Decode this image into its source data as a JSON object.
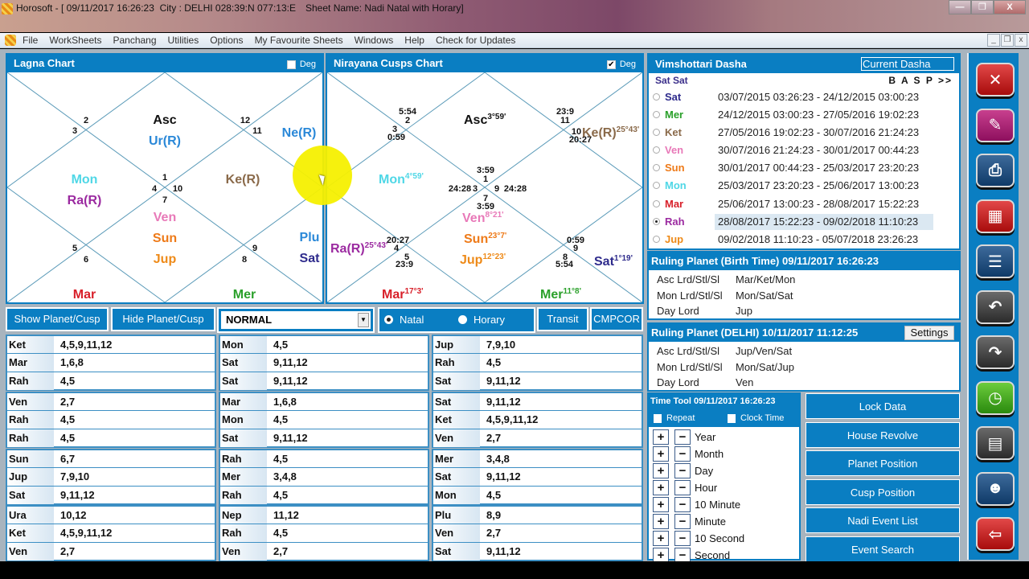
{
  "window": {
    "title": "Horosoft - [ 09/11/2017 16:26:23  City : DELHI 028:39:N 077:13:E",
    "sheet_name": "Sheet Name: Nadi Natal with Horary]",
    "controls": {
      "minimize": "—",
      "restore": "❐",
      "close": "X"
    }
  },
  "menu": {
    "items": [
      "File",
      "WorkSheets",
      "Panchang",
      "Utilities",
      "Options",
      "My Favourite Sheets",
      "Windows",
      "Help",
      "Check for Updates"
    ],
    "mdi_controls": {
      "minimize": "_",
      "restore": "❐",
      "close": "x"
    }
  },
  "colors": {
    "accent": "#0a7ec2",
    "Asc": "#111111",
    "Ura": "#2a88d8",
    "Nep": "#2a88d8",
    "Mon": "#4fd7e6",
    "Rah": "#9b2aa0",
    "Ket": "#8a6a4a",
    "Ven": "#e879b8",
    "Sun": "#ee7a18",
    "Jup": "#ee8a18",
    "Plu": "#2a88d8",
    "Sat": "#2e2b8c",
    "Mar": "#d8202a",
    "Mer": "#2aa02a"
  },
  "lagna_chart": {
    "title": "Lagna Chart",
    "deg_label": "Deg",
    "deg_checked": false,
    "house_numbers": [
      "1",
      "2",
      "3",
      "4",
      "5",
      "6",
      "7",
      "8",
      "9",
      "10",
      "11",
      "12"
    ],
    "planets": [
      {
        "text": "Asc",
        "key": "Asc",
        "house": 1
      },
      {
        "text": "Ur(R)",
        "key": "Ura",
        "house": 1
      },
      {
        "text": "Ne(R)",
        "key": "Nep",
        "house": 11
      },
      {
        "text": "Mon",
        "key": "Mon",
        "house": 4
      },
      {
        "text": "Ra(R)",
        "key": "Rah",
        "house": 4
      },
      {
        "text": "Ke(R)",
        "key": "Ket",
        "house": 10
      },
      {
        "text": "Ven",
        "key": "Ven",
        "house": 7
      },
      {
        "text": "Sun",
        "key": "Sun",
        "house": 7
      },
      {
        "text": "Jup",
        "key": "Jup",
        "house": 7
      },
      {
        "text": "Plu",
        "key": "Plu",
        "house": 9
      },
      {
        "text": "Sat",
        "key": "Sat",
        "house": 9
      },
      {
        "text": "Mar",
        "key": "Mar",
        "house": 6
      },
      {
        "text": "Mer",
        "key": "Mer",
        "house": 8
      }
    ]
  },
  "cusps_chart": {
    "title": "Nirayana Cusps Chart",
    "deg_label": "Deg",
    "deg_checked": true,
    "cusp_degrees": {
      "1": "3:59",
      "2": "5:54",
      "3": "0:59",
      "3c": "24:28",
      "4": "20:27",
      "5": "23:9",
      "7": "3:59",
      "8": "5:54",
      "9": "0:59",
      "9c": "24:28",
      "10": "20:27",
      "11": "23:9"
    },
    "planets": [
      {
        "text": "Asc",
        "deg": "3°59'",
        "key": "Asc",
        "house": 1
      },
      {
        "text": "Ke(R)",
        "deg": "25°43'",
        "key": "Ket",
        "house": 10
      },
      {
        "text": "Mon",
        "deg": "4°59'",
        "key": "Mon",
        "house": 4
      },
      {
        "text": "Ven",
        "deg": "8°21'",
        "key": "Ven",
        "house": 7
      },
      {
        "text": "Sun",
        "deg": "23°7'",
        "key": "Sun",
        "house": 7
      },
      {
        "text": "Jup",
        "deg": "12°23'",
        "key": "Jup",
        "house": 7
      },
      {
        "text": "Ra(R)",
        "deg": "25°43'",
        "key": "Rah",
        "house": 4
      },
      {
        "text": "Sat",
        "deg": "1°19'",
        "key": "Sat",
        "house": 9
      },
      {
        "text": "Mar",
        "deg": "17°3'",
        "key": "Mar",
        "house": 6
      },
      {
        "text": "Mer",
        "deg": "11°8'",
        "key": "Mer",
        "house": 8
      }
    ]
  },
  "controls": {
    "show_planet_cusp": "Show Planet/Cusp",
    "hide_planet_cusp": "Hide Planet/Cusp",
    "mode_select": "NORMAL",
    "radio_natal": "Natal",
    "radio_horary": "Horary",
    "selected_radio": "Natal",
    "transit": "Transit",
    "cmpcor": "CMPCOR"
  },
  "significators": [
    [
      [
        [
          "Ket",
          "4,5,9,11,12"
        ],
        [
          "Mar",
          "1,6,8"
        ],
        [
          "Rah",
          "4,5"
        ]
      ],
      [
        [
          "Ven",
          "2,7"
        ],
        [
          "Rah",
          "4,5"
        ],
        [
          "Rah",
          "4,5"
        ]
      ],
      [
        [
          "Sun",
          "6,7"
        ],
        [
          "Jup",
          "7,9,10"
        ],
        [
          "Sat",
          "9,11,12"
        ]
      ],
      [
        [
          "Ura",
          "10,12"
        ],
        [
          "Ket",
          "4,5,9,11,12"
        ],
        [
          "Ven",
          "2,7"
        ]
      ]
    ],
    [
      [
        [
          "Mon",
          "4,5"
        ],
        [
          "Sat",
          "9,11,12"
        ],
        [
          "Sat",
          "9,11,12"
        ]
      ],
      [
        [
          "Mar",
          "1,6,8"
        ],
        [
          "Mon",
          "4,5"
        ],
        [
          "Sat",
          "9,11,12"
        ]
      ],
      [
        [
          "Rah",
          "4,5"
        ],
        [
          "Mer",
          "3,4,8"
        ],
        [
          "Rah",
          "4,5"
        ]
      ],
      [
        [
          "Nep",
          "11,12"
        ],
        [
          "Rah",
          "4,5"
        ],
        [
          "Ven",
          "2,7"
        ]
      ]
    ],
    [
      [
        [
          "Jup",
          "7,9,10"
        ],
        [
          "Rah",
          "4,5"
        ],
        [
          "Sat",
          "9,11,12"
        ]
      ],
      [
        [
          "Sat",
          "9,11,12"
        ],
        [
          "Ket",
          "4,5,9,11,12"
        ],
        [
          "Ven",
          "2,7"
        ]
      ],
      [
        [
          "Mer",
          "3,4,8"
        ],
        [
          "Sat",
          "9,11,12"
        ],
        [
          "Mon",
          "4,5"
        ]
      ],
      [
        [
          "Plu",
          "8,9"
        ],
        [
          "Ven",
          "2,7"
        ],
        [
          "Sat",
          "9,11,12"
        ]
      ]
    ]
  ],
  "dasha": {
    "title": "Vimshottari Dasha",
    "current_button": "Current Dasha",
    "lords": "Sat  Sat",
    "nav": "B A S P >>",
    "rows": [
      {
        "planet": "Sat",
        "key": "Sat",
        "period": "03/07/2015 03:26:23 - 24/12/2015 03:00:23",
        "selected": false
      },
      {
        "planet": "Mer",
        "key": "Mer",
        "period": "24/12/2015 03:00:23 - 27/05/2016 19:02:23",
        "selected": false
      },
      {
        "planet": "Ket",
        "key": "Ket",
        "period": "27/05/2016 19:02:23 - 30/07/2016 21:24:23",
        "selected": false
      },
      {
        "planet": "Ven",
        "key": "Ven",
        "period": "30/07/2016 21:24:23 - 30/01/2017 00:44:23",
        "selected": false
      },
      {
        "planet": "Sun",
        "key": "Sun",
        "period": "30/01/2017 00:44:23 - 25/03/2017 23:20:23",
        "selected": false
      },
      {
        "planet": "Mon",
        "key": "Mon",
        "period": "25/03/2017 23:20:23 - 25/06/2017 13:00:23",
        "selected": false
      },
      {
        "planet": "Mar",
        "key": "Mar",
        "period": "25/06/2017 13:00:23 - 28/08/2017 15:22:23",
        "selected": false
      },
      {
        "planet": "Rah",
        "key": "Rah",
        "period": "28/08/2017 15:22:23 - 09/02/2018 11:10:23",
        "selected": true
      },
      {
        "planet": "Jup",
        "key": "Jup",
        "period": "09/02/2018 11:10:23 - 05/07/2018 23:26:23",
        "selected": false
      }
    ]
  },
  "ruling_birth": {
    "title": "Ruling Planet (Birth Time) 09/11/2017 16:26:23",
    "rows": [
      [
        "Asc Lrd/Stl/Sl",
        "Mar/Ket/Mon"
      ],
      [
        "Mon Lrd/Stl/Sl",
        "Mon/Sat/Sat"
      ],
      [
        "Day Lord",
        "Jup"
      ]
    ]
  },
  "ruling_delhi": {
    "title": "Ruling Planet (DELHI) 10/11/2017 11:12:25",
    "settings": "Settings",
    "rows": [
      [
        "Asc Lrd/Stl/Sl",
        "Jup/Ven/Sat"
      ],
      [
        "Mon Lrd/Stl/Sl",
        "Mon/Sat/Jup"
      ],
      [
        "Day Lord",
        "Ven"
      ]
    ]
  },
  "time_tool": {
    "title": "Time Tool 09/11/2017 16:26:23",
    "repeat": "Repeat",
    "clock_time": "Clock Time",
    "plus": "+",
    "minus": "−",
    "units": [
      "Year",
      "Month",
      "Day",
      "Hour",
      "10 Minute",
      "Minute",
      "10 Second",
      "Second"
    ]
  },
  "actions": [
    "Lock Data",
    "House Revolve",
    "Planet Position",
    "Cusp Position",
    "Nadi Event List",
    "Event Search"
  ],
  "toolbar": [
    {
      "name": "settings-tools-icon",
      "glyph": "✕",
      "style": "red"
    },
    {
      "name": "edit-icon",
      "glyph": "✎",
      "style": "mag"
    },
    {
      "name": "print-icon",
      "glyph": "⎙",
      "style": "navy"
    },
    {
      "name": "calendar-icon",
      "glyph": "▦",
      "style": "red"
    },
    {
      "name": "document-icon",
      "glyph": "☰",
      "style": "navy"
    },
    {
      "name": "back-arrow-icon",
      "glyph": "↶",
      "style": "dark"
    },
    {
      "name": "forward-arrow-icon",
      "glyph": "↷",
      "style": "dark"
    },
    {
      "name": "alarm-clock-icon",
      "glyph": "◷",
      "style": "green"
    },
    {
      "name": "notebook-icon",
      "glyph": "▤",
      "style": "dark"
    },
    {
      "name": "group-icon",
      "glyph": "☻",
      "style": "navy"
    },
    {
      "name": "exit-icon",
      "glyph": "⇦",
      "style": "red"
    }
  ]
}
